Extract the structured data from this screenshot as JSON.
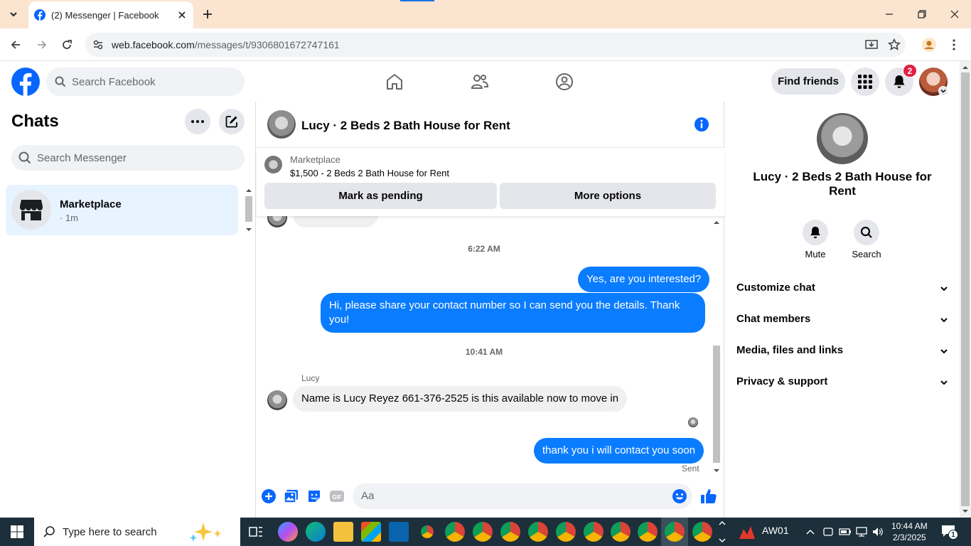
{
  "browser": {
    "tab_title": "(2) Messenger | Facebook",
    "url_host": "web.facebook.com",
    "url_path": "/messages/t/9306801672747161"
  },
  "fb_header": {
    "search_placeholder": "Search Facebook",
    "find_friends_label": "Find friends",
    "notification_count": "2"
  },
  "chats": {
    "title": "Chats",
    "search_placeholder": "Search Messenger",
    "items": [
      {
        "name": "Marketplace",
        "time": "· 1m"
      }
    ]
  },
  "conversation": {
    "title": "Lucy · 2 Beds 2 Bath House for Rent",
    "listing": {
      "label": "Marketplace",
      "title": "$1,500 - 2 Beds 2 Bath House for Rent",
      "mark_pending_label": "Mark as pending",
      "more_options_label": "More options"
    },
    "messages": [
      {
        "type": "timestamp",
        "text": "6:22 AM"
      },
      {
        "type": "outgoing",
        "text": "Yes, are you interested?"
      },
      {
        "type": "outgoing",
        "text": "Hi, please share your contact number so I can send you the details. Thank you!"
      },
      {
        "type": "timestamp",
        "text": "10:41 AM"
      },
      {
        "type": "sender",
        "text": "Lucy"
      },
      {
        "type": "incoming",
        "text": "Name is Lucy Reyez 661-376-2525 is this available now to move in"
      },
      {
        "type": "outgoing",
        "text": "thank you i will contact you soon"
      },
      {
        "type": "status",
        "text": "Sent"
      }
    ],
    "composer_placeholder": "Aa"
  },
  "details": {
    "name": "Lucy · 2 Beds 2 Bath House for Rent",
    "actions": [
      {
        "label": "Mute",
        "icon": "bell-icon"
      },
      {
        "label": "Search",
        "icon": "search-icon"
      }
    ],
    "sections": [
      "Customize chat",
      "Chat members",
      "Media, files and links",
      "Privacy & support"
    ]
  },
  "taskbar": {
    "search_placeholder": "Type here to search",
    "weather": "AW01",
    "time": "10:44 AM",
    "date": "2/3/2025",
    "notification_count": "1"
  },
  "colors": {
    "brand_blue": "#0866ff",
    "bubble_blue": "#0a7cff",
    "tab_strip": "#fbe4d0",
    "badge_red": "#e41e3f",
    "taskbar": "#1c2f3b"
  }
}
